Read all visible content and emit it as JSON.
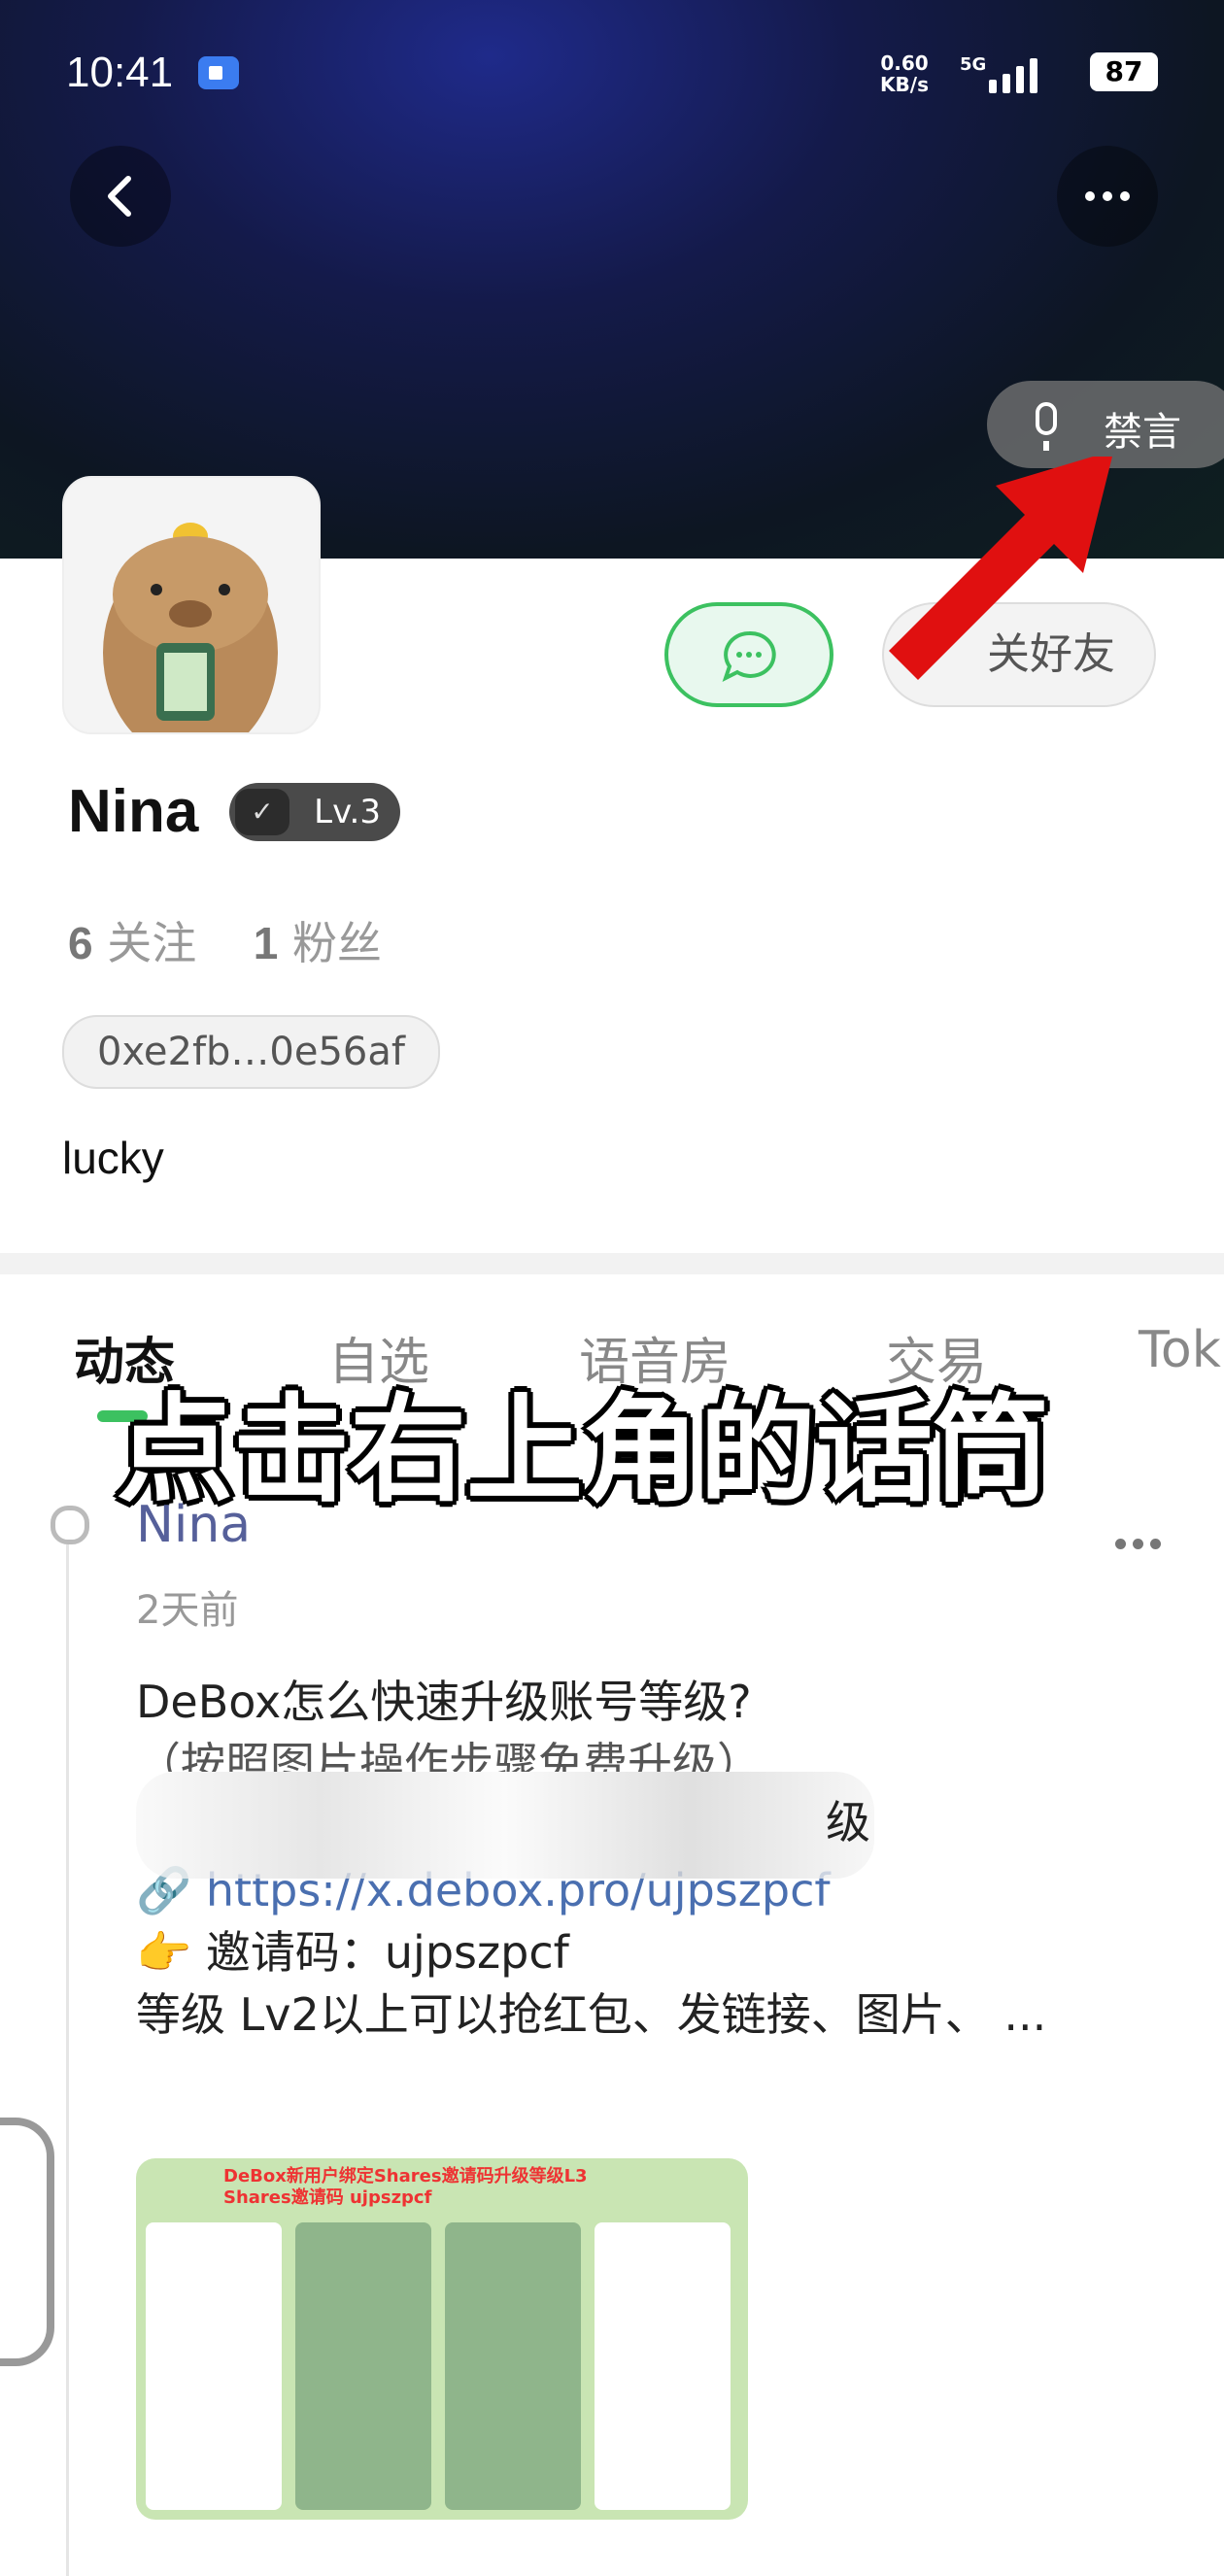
{
  "status_bar": {
    "time": "10:41",
    "speed": "0.60",
    "speed_unit": "KB/s",
    "network": "5G",
    "battery": "87"
  },
  "header": {
    "mute_label": "禁言"
  },
  "profile": {
    "name": "Nina",
    "level": "Lv.3",
    "following_count": "6",
    "following_label": "关注",
    "followers_count": "1",
    "followers_label": "粉丝",
    "address": "0xe2fb…0e56af",
    "bio": "lucky",
    "friend_button": "关好友"
  },
  "tabs": [
    "动态",
    "自选",
    "语音房",
    "交易",
    "Tok"
  ],
  "caption": "点击右上角的话筒",
  "post": {
    "author": "Nina",
    "time": "2天前",
    "line1": "DeBox怎么快速升级账号等级?",
    "line2": "（按照图片操作步骤免费升级）",
    "line3_tail": "级",
    "link": "https://x.debox.pro/ujpszpcf",
    "invite": "邀请码：ujpszpcf",
    "line5": "等级 Lv2以上可以抢红包、发链接、图片、 ...",
    "image_title_1": "DeBox新用户绑定Shares邀请码升级等级L3",
    "image_title_2": "Shares邀请码 ujpszpcf"
  },
  "colors": {
    "accent": "#3cc160",
    "arrow": "#e01010",
    "link": "#4a6fb0"
  },
  "icons": [
    "back-icon",
    "more-icon",
    "mic-icon",
    "chat-icon",
    "link-icon",
    "point-icon"
  ]
}
